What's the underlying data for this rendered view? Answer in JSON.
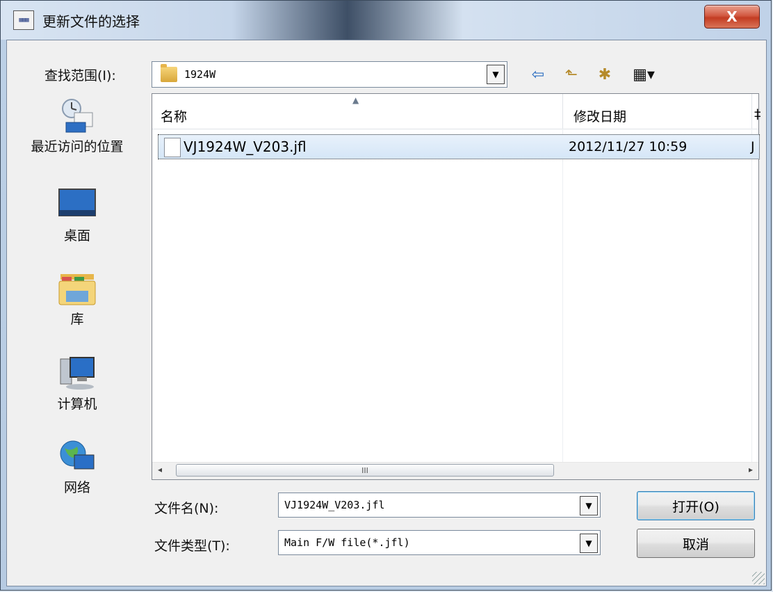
{
  "window": {
    "title": "更新文件的选择",
    "app_icon_text": "▦▦▦",
    "close_glyph": "X"
  },
  "lookin": {
    "label": "查找范围(I):",
    "value": "1924W",
    "dropdown_glyph": "▼"
  },
  "toolbar": {
    "back_icon": "⇦",
    "up_icon": "⬑",
    "new_folder_icon": "✱",
    "view_icon": "▦▾"
  },
  "places": [
    {
      "label": "最近访问的位置",
      "icon": "recent-places-icon"
    },
    {
      "label": "桌面",
      "icon": "desktop-icon"
    },
    {
      "label": "库",
      "icon": "libraries-icon"
    },
    {
      "label": "计算机",
      "icon": "computer-icon"
    },
    {
      "label": "网络",
      "icon": "network-icon"
    }
  ],
  "filelist": {
    "columns": [
      "名称",
      "修改日期",
      "‡"
    ],
    "sort_glyph": "▲",
    "rows": [
      {
        "name": "VJ1924W_V203.jfl",
        "modified": "2012/11/27 10:59",
        "type": "J"
      }
    ],
    "hscroll_thumb": "III",
    "arrow_left": "◂",
    "arrow_right": "▸"
  },
  "filename": {
    "label": "文件名(N):",
    "value": "VJ1924W_V203.jfl"
  },
  "filetype": {
    "label": "文件类型(T):",
    "value": "Main F/W file(*.jfl)"
  },
  "buttons": {
    "open": "打开(O)",
    "cancel": "取消"
  },
  "colors": {
    "close_red": "#c33c22",
    "selection": "#d5e6f7"
  }
}
